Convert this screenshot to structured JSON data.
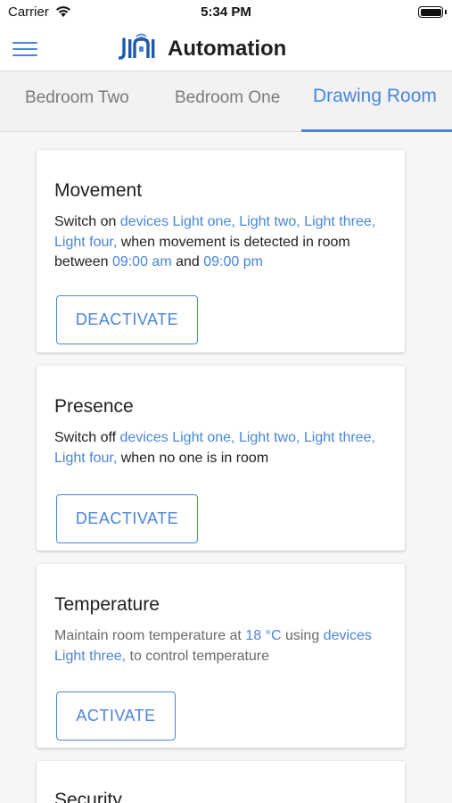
{
  "status_bar": {
    "carrier": "Carrier",
    "time": "5:34 PM"
  },
  "header": {
    "title": "Automation",
    "logo_alt": "JIAI"
  },
  "tabs": [
    {
      "label": "Bedroom Two",
      "active": false
    },
    {
      "label": "Bedroom One",
      "active": false
    },
    {
      "label": "Drawing Room",
      "active": true
    }
  ],
  "cards": [
    {
      "title": "Movement",
      "desc": {
        "p1": "Switch on ",
        "h1": "devices Light one, Light two, Light three, Light four,",
        "p2": " when movement is detected in room between ",
        "h2": "09:00 am",
        "p3": "  and ",
        "h3": "09:00 pm"
      },
      "button": "DEACTIVATE"
    },
    {
      "title": "Presence",
      "desc": {
        "p1": "Switch off ",
        "h1": "devices Light one, Light two, Light three, Light four,",
        "p2": " when no one is in room"
      },
      "button": "DEACTIVATE"
    },
    {
      "title": "Temperature",
      "desc": {
        "p1": "Maintain room temperature at ",
        "h1": "18 °C",
        "p2": " using ",
        "h2": "devices Light three,",
        "p3": " to control temperature"
      },
      "button": "ACTIVATE"
    },
    {
      "title": "Security"
    }
  ],
  "colors": {
    "accent": "#4a86d8",
    "text": "#1f1f1f",
    "muted": "#6a6a6a",
    "background": "#f6f6f6"
  },
  "icons": [
    "wifi-icon",
    "battery-icon",
    "menu-icon",
    "jiai-logo"
  ]
}
